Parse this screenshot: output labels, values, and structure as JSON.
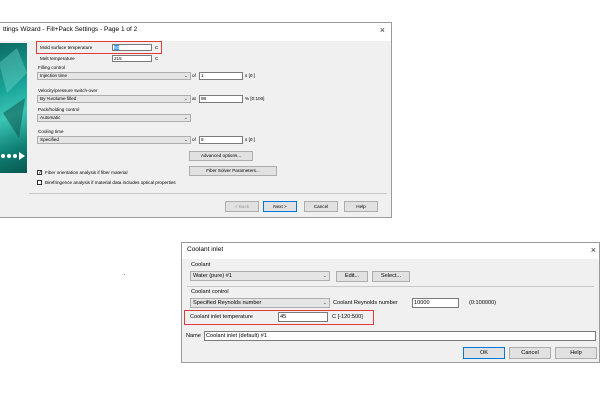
{
  "wizard": {
    "title": "ttings Wizard - Fill+Pack Settings - Page 1 of 2",
    "close_glyph": "×",
    "mold_surface_temperature": {
      "label": "Mold surface temperature",
      "value": "50",
      "unit": "C"
    },
    "melt_temperature": {
      "label": "Melt temperature",
      "value": "215",
      "unit": "C"
    },
    "filling_control": {
      "label": "Filling control",
      "selected": "Injection time",
      "of_label": "of",
      "value": "1",
      "unit": "s [0:]"
    },
    "velocity_pressure": {
      "label": "Velocity/pressure switch-over",
      "selected": "By %volume filled",
      "at_label": "at",
      "value": "98",
      "unit": "% [0:100]"
    },
    "pack_holding": {
      "label": "Pack/holding control",
      "selected": "Automatic"
    },
    "cooling_time": {
      "label": "Cooling time",
      "selected": "Specified",
      "of_label": "of",
      "value": "9",
      "unit": "s [0:]"
    },
    "advanced_options": "Advanced options...",
    "fiber_solver": "Fiber Solver Parameters...",
    "fiber_orientation": {
      "label": "Fiber orientation analysis if fiber material",
      "checked": true
    },
    "birefringence": {
      "label": "Birefringence analysis if material data includes optical properties",
      "checked": false
    },
    "back": "< Back",
    "next": "Next >",
    "cancel": "Cancel",
    "help": "Help"
  },
  "coolant": {
    "title": "Coolant inlet",
    "close_glyph": "×",
    "coolant_group_label": "Coolant",
    "coolant_selected": "Water (pure) #1",
    "edit": "Edit...",
    "select": "Select...",
    "control_group_label": "Coolant control",
    "control_selected": "Specified Reynolds number",
    "reynolds_label": "Coolant Reynolds number",
    "reynolds_value": "10000",
    "reynolds_range": "(0:100000)",
    "temp_label": "Coolant inlet temperature",
    "temp_value": "45",
    "temp_unit": "C [-120:500]",
    "name_label": "Name",
    "name_value": "Coolant inlet (default) #1",
    "ok": "OK",
    "cancel": "Cancel",
    "help": "Help"
  },
  "colors": {
    "highlight": "#e03b3b",
    "teal": "#1aa59a",
    "selection": "#3399ff"
  }
}
